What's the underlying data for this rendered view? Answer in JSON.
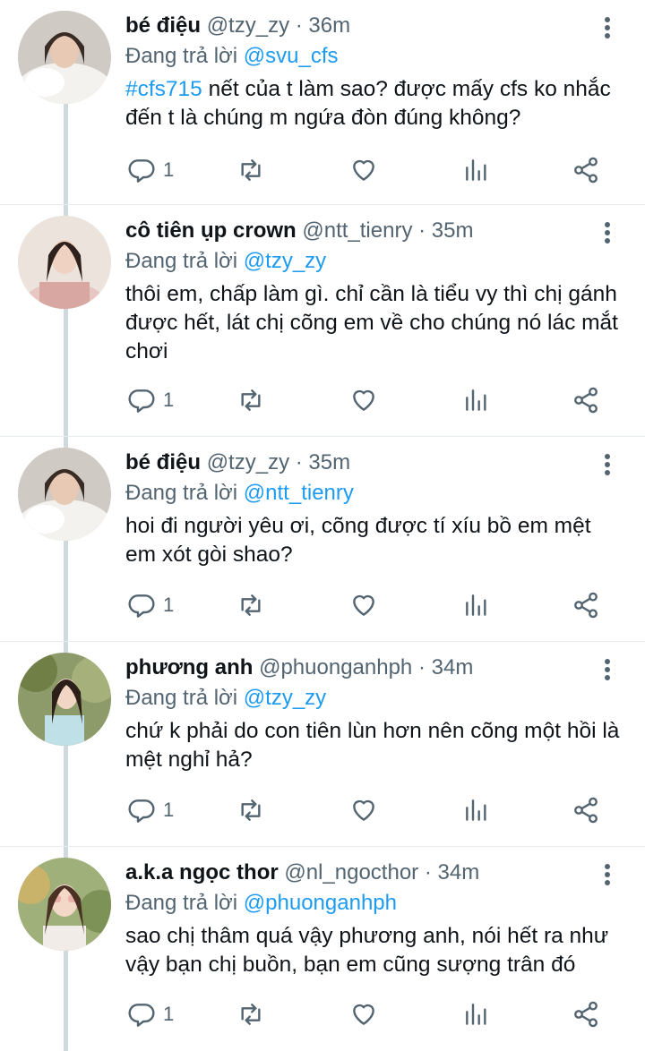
{
  "colors": {
    "link": "#1d9bf0",
    "text": "#0f1419",
    "muted": "#536471",
    "thread_line": "#cfd9de"
  },
  "icons": [
    "reply-icon",
    "retweet-icon",
    "like-icon",
    "analytics-icon",
    "share-icon",
    "more-options-icon"
  ],
  "tweets": [
    {
      "name": "bé điệu",
      "handle": "@tzy_zy",
      "sep": "·",
      "time": "36m",
      "reply_prefix": "Đang trả lời",
      "reply_to": "@svu_cfs",
      "hashtag": "#cfs715",
      "text": " nết của t làm sao? được mấy cfs ko nhắc đến t là chúng m ngứa đòn đúng không?",
      "replies": "1"
    },
    {
      "name": "cô tiên ụp crown",
      "handle": "@ntt_tienry",
      "sep": "·",
      "time": "35m",
      "reply_prefix": "Đang trả lời",
      "reply_to": "@tzy_zy",
      "hashtag": "",
      "text": "thôi em, chấp làm gì. chỉ cần là tiểu vy thì chị gánh được hết, lát chị cõng em về cho chúng nó lác mắt chơi",
      "replies": "1"
    },
    {
      "name": "bé điệu",
      "handle": "@tzy_zy",
      "sep": "·",
      "time": "35m",
      "reply_prefix": "Đang trả lời",
      "reply_to": "@ntt_tienry",
      "hashtag": "",
      "text": "hoi đi người yêu ơi, cõng được tí xíu bồ em mệt em xót gòi shao?",
      "replies": "1"
    },
    {
      "name": "phương anh",
      "handle": "@phuonganhph",
      "sep": "·",
      "time": "34m",
      "reply_prefix": "Đang trả lời",
      "reply_to": "@tzy_zy",
      "hashtag": "",
      "text": "chứ k phải do con tiên lùn hơn nên cõng một hồi là mệt nghỉ hả?",
      "replies": "1"
    },
    {
      "name": "a.k.a ngọc thor",
      "handle": "@nl_ngocthor",
      "sep": "·",
      "time": "34m",
      "reply_prefix": "Đang trả lời",
      "reply_to": "@phuonganhph",
      "hashtag": "",
      "text": "sao chị thâm quá vậy phương anh, nói hết ra như vậy bạn chị buồn, bạn em cũng sượng trân đó",
      "replies": "1"
    }
  ]
}
